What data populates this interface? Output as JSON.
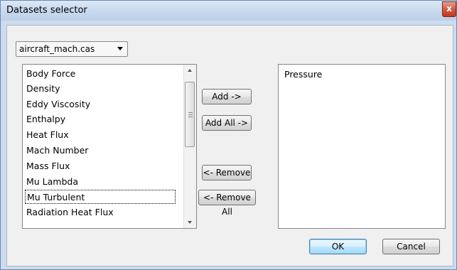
{
  "window": {
    "title": "Datasets selector",
    "close_glyph": "x"
  },
  "dataset_combo": {
    "selected": "aircraft_mach.cas"
  },
  "available_list": {
    "items": [
      "Body Force",
      "Density",
      "Eddy Viscosity",
      "Enthalpy",
      "Heat Flux",
      "Mach Number",
      "Mass Flux",
      "Mu Lambda",
      "Mu Turbulent",
      "Radiation Heat Flux"
    ],
    "focused_item": "Mu Turbulent"
  },
  "buttons": {
    "add": "Add ->",
    "add_all": "Add All ->",
    "remove": "<- Remove",
    "remove_all": "<- Remove All",
    "ok": "OK",
    "cancel": "Cancel"
  },
  "selected_list": {
    "items": [
      "Pressure"
    ]
  }
}
